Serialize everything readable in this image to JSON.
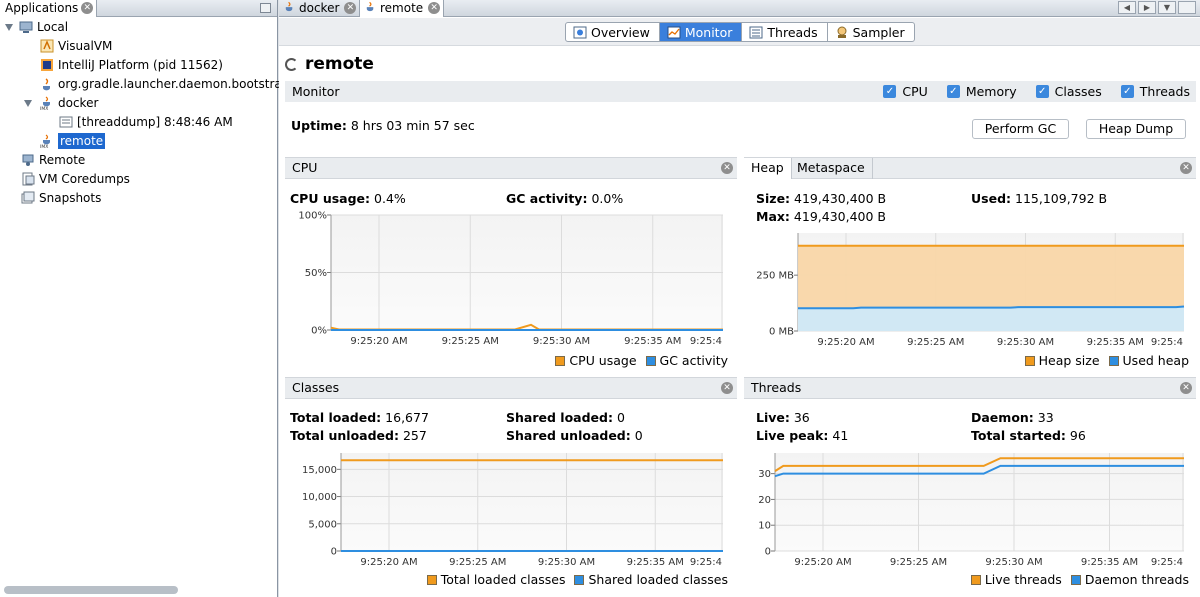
{
  "colors": {
    "orange": "#f09a1d",
    "blue": "#2e8ee0",
    "selection": "#1e68cf",
    "seg_active": "#3a7fdc"
  },
  "left": {
    "tab_label": "Applications",
    "tree": [
      {
        "label": "Local",
        "icon": "computer-icon"
      },
      {
        "label": "VisualVM",
        "icon": "visualvm-icon"
      },
      {
        "label": "IntelliJ Platform (pid 11562)",
        "icon": "intellij-icon"
      },
      {
        "label": "org.gradle.launcher.daemon.bootstrap.G",
        "icon": "java-icon"
      },
      {
        "label": "docker",
        "icon": "jmx-icon"
      },
      {
        "label": "[threaddump] 8:48:46 AM",
        "icon": "threaddump-icon"
      },
      {
        "label": "remote",
        "icon": "jmx-icon",
        "selected": true
      },
      {
        "label": "Remote",
        "icon": "remote-icon"
      },
      {
        "label": "VM Coredumps",
        "icon": "coredump-icon"
      },
      {
        "label": "Snapshots",
        "icon": "snapshots-icon"
      }
    ]
  },
  "doc_tabs": [
    {
      "label": "docker"
    },
    {
      "label": "remote",
      "active": true
    }
  ],
  "view_tabs": [
    {
      "label": "Overview",
      "icon": "overview-icon"
    },
    {
      "label": "Monitor",
      "icon": "monitor-icon",
      "active": true
    },
    {
      "label": "Threads",
      "icon": "threads-icon"
    },
    {
      "label": "Sampler",
      "icon": "sampler-icon"
    }
  ],
  "title": "remote",
  "monitor": {
    "section_label": "Monitor",
    "checks": [
      {
        "label": "CPU",
        "checked": true
      },
      {
        "label": "Memory",
        "checked": true
      },
      {
        "label": "Classes",
        "checked": true
      },
      {
        "label": "Threads",
        "checked": true
      }
    ],
    "uptime_label": "Uptime:",
    "uptime_value": "8 hrs 03 min 57 sec",
    "perform_gc": "Perform GC",
    "heap_dump": "Heap Dump"
  },
  "cpu": {
    "title": "CPU",
    "usage_label": "CPU usage:",
    "usage_value": "0.4%",
    "gc_label": "GC activity:",
    "gc_value": "0.0%",
    "legend": [
      "CPU usage",
      "GC activity"
    ]
  },
  "memory": {
    "tabs": [
      "Heap",
      "Metaspace"
    ],
    "size_label": "Size:",
    "size_value": "419,430,400 B",
    "max_label": "Max:",
    "max_value": "419,430,400 B",
    "used_label": "Used:",
    "used_value": "115,109,792 B",
    "legend": [
      "Heap size",
      "Used heap"
    ]
  },
  "classes": {
    "title": "Classes",
    "total_loaded_label": "Total loaded:",
    "total_loaded_value": "16,677",
    "total_unloaded_label": "Total unloaded:",
    "total_unloaded_value": "257",
    "shared_loaded_label": "Shared loaded:",
    "shared_loaded_value": "0",
    "shared_unloaded_label": "Shared unloaded:",
    "shared_unloaded_value": "0",
    "legend": [
      "Total loaded classes",
      "Shared loaded classes"
    ]
  },
  "threads": {
    "title": "Threads",
    "live_label": "Live:",
    "live_value": "36",
    "peak_label": "Live peak:",
    "peak_value": "41",
    "daemon_label": "Daemon:",
    "daemon_value": "33",
    "started_label": "Total started:",
    "started_value": "96",
    "legend": [
      "Live threads",
      "Daemon threads"
    ]
  },
  "chart_data": [
    {
      "type": "line",
      "id": "cpu",
      "x_ticks": [
        "9:25:20 AM",
        "9:25:25 AM",
        "9:25:30 AM",
        "9:25:35 AM",
        "9:25:4"
      ],
      "y_ticks": [
        "100%",
        "50%",
        "0%"
      ],
      "ylim": [
        0,
        100
      ],
      "xlim": [
        0,
        49
      ],
      "series": [
        {
          "name": "CPU usage",
          "x": [
            0,
            1,
            2,
            23,
            25,
            26,
            49
          ],
          "values": [
            2,
            0.4,
            0.4,
            0.4,
            4.5,
            0.4,
            0.4
          ]
        },
        {
          "name": "GC activity",
          "x": [
            0,
            49
          ],
          "values": [
            0,
            0
          ]
        }
      ]
    },
    {
      "type": "area",
      "id": "heap",
      "x_ticks": [
        "9:25:20 AM",
        "9:25:25 AM",
        "9:25:30 AM",
        "9:25:35 AM",
        "9:25:4"
      ],
      "y_ticks": [
        "250 MB",
        "0 MB"
      ],
      "ylim": [
        0,
        460
      ],
      "xlim": [
        0,
        49
      ],
      "series": [
        {
          "name": "Heap size",
          "x": [
            0,
            49
          ],
          "values": [
            400,
            400
          ]
        },
        {
          "name": "Used heap",
          "x": [
            0,
            7,
            8,
            27,
            28,
            48,
            49
          ],
          "values": [
            107,
            107,
            110,
            110,
            112,
            112,
            115
          ]
        }
      ]
    },
    {
      "type": "line",
      "id": "classes",
      "x_ticks": [
        "9:25:20 AM",
        "9:25:25 AM",
        "9:25:30 AM",
        "9:25:35 AM",
        "9:25:4"
      ],
      "y_ticks": [
        "15,000",
        "10,000",
        "5,000",
        "0"
      ],
      "ylim": [
        0,
        18000
      ],
      "xlim": [
        0,
        49
      ],
      "series": [
        {
          "name": "Total loaded classes",
          "x": [
            0,
            49
          ],
          "values": [
            16677,
            16677
          ]
        },
        {
          "name": "Shared loaded classes",
          "x": [
            0,
            49
          ],
          "values": [
            0,
            0
          ]
        }
      ]
    },
    {
      "type": "line",
      "id": "threads",
      "x_ticks": [
        "9:25:20 AM",
        "9:25:25 AM",
        "9:25:30 AM",
        "9:25:35 AM",
        "9:25:4"
      ],
      "y_ticks": [
        "30",
        "20",
        "10",
        "0"
      ],
      "ylim": [
        0,
        38
      ],
      "xlim": [
        0,
        49
      ],
      "series": [
        {
          "name": "Live threads",
          "x": [
            0,
            1,
            25,
            27,
            49
          ],
          "values": [
            31,
            33,
            33,
            36,
            36
          ]
        },
        {
          "name": "Daemon threads",
          "x": [
            0,
            1,
            25,
            27,
            49
          ],
          "values": [
            29,
            30,
            30,
            33,
            33
          ]
        }
      ]
    }
  ]
}
